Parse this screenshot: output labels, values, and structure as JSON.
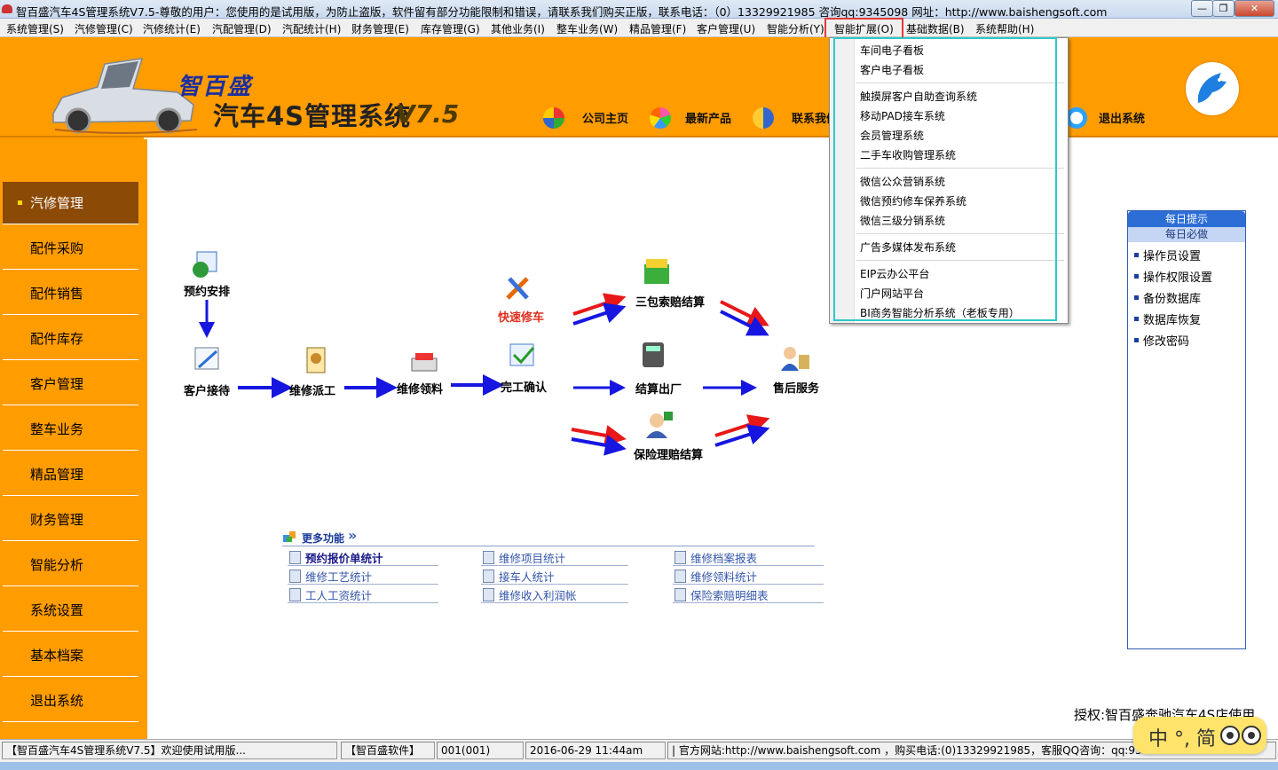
{
  "window": {
    "title": "智百盛汽车4S管理系统V7.5-尊敬的用户：您使用的是试用版，为防止盗版，软件留有部分功能限制和错误，请联系我们购买正版，联系电话：（0）13329921985  咨询qq:9345098  网址：http://www.baishengsoft.com",
    "minimize": "—",
    "restore": "❐",
    "close": "✕"
  },
  "menu": [
    "系统管理(S)",
    "汽修管理(C)",
    "汽修统计(E)",
    "汽配管理(D)",
    "汽配统计(H)",
    "财务管理(E)",
    "库存管理(G)",
    "其他业务(I)",
    "整车业务(W)",
    "精品管理(F)",
    "客户管理(U)",
    "智能分析(Y)",
    "智能扩展(O)",
    "基础数据(B)",
    "系统帮助(H)"
  ],
  "header": {
    "brand_small": "智百盛",
    "brand_main": "汽车4S管理系统",
    "version": "V7.5",
    "nav": [
      "公司主页",
      "最新产品",
      "联系我们",
      "退出系统"
    ]
  },
  "sidebar": [
    "汽修管理",
    "配件采购",
    "配件销售",
    "配件库存",
    "客户管理",
    "整车业务",
    "精品管理",
    "财务管理",
    "智能分析",
    "系统设置",
    "基本档案",
    "退出系统"
  ],
  "dropdown": [
    [
      "车间电子看板",
      "客户电子看板"
    ],
    [
      "触摸屏客户自助查询系统",
      "移动PAD接车系统",
      "会员管理系统",
      "二手车收购管理系统"
    ],
    [
      "微信公众营销系统",
      "微信预约修车保养系统",
      "微信三级分销系统"
    ],
    [
      "广告多媒体发布系统"
    ],
    [
      "EIP云办公平台",
      "门户网站平台",
      "BI商务智能分析系统（老板专用）"
    ]
  ],
  "flow": {
    "appointment": "预约安排",
    "reception": "客户接待",
    "dispatch": "维修派工",
    "material": "维修领料",
    "completion": "完工确认",
    "quick_repair": "快速修车",
    "warranty": "三包索赔结算",
    "checkout": "结算出厂",
    "insurance": "保险理赔结算",
    "after_sales": "售后服务"
  },
  "more": {
    "title": "更多功能",
    "arrow": "»",
    "links": [
      [
        "预约报价单统计",
        "维修项目统计",
        "维修档案报表"
      ],
      [
        "维修工艺统计",
        "接车人统计",
        "维修领料统计"
      ],
      [
        "工人工资统计",
        "维修收入利润帐",
        "保险索赔明细表"
      ]
    ]
  },
  "tips": {
    "title": "每日提示",
    "subtitle": "每日必做",
    "items": [
      "操作员设置",
      "操作权限设置",
      "备份数据库",
      "数据库恢复",
      "修改密码"
    ]
  },
  "authorization": "授权:智百盛奔驰汽车4S店使用",
  "statusbar": {
    "welcome": "【智百盛汽车4S管理系统V7.5】欢迎使用试用版...",
    "company": "【智百盛软件】",
    "user": "001(001)",
    "datetime": "2016-06-29  11:44am",
    "info": "|  官方网站:http://www.baishengsoft.com  ，购买电话:(0)13329921985，客服QQ咨询：qq:9345098"
  },
  "ime": {
    "text": "中 °, 简"
  },
  "colors": {
    "orange": "#ff9c00",
    "sidebar_active": "#8b4a05",
    "highlight_red": "#e23a3a",
    "dropdown_frame": "#2fc8c8",
    "tips_header": "#2d6dd6"
  }
}
